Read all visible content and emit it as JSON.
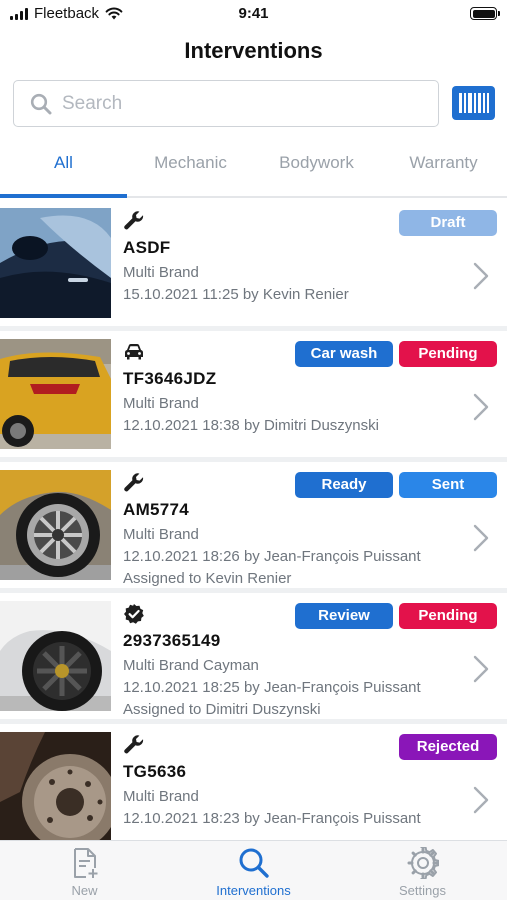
{
  "status_bar": {
    "carrier": "Fleetback",
    "time": "9:41"
  },
  "header": {
    "title": "Interventions"
  },
  "search": {
    "placeholder": "Search",
    "value": ""
  },
  "tabs": [
    {
      "label": "All",
      "active": true
    },
    {
      "label": "Mechanic",
      "active": false
    },
    {
      "label": "Bodywork",
      "active": false
    },
    {
      "label": "Warranty",
      "active": false
    }
  ],
  "interventions": [
    {
      "icon": "wrench-icon",
      "plate": "ASDF",
      "brand": "Multi Brand",
      "meta": "15.10.2021 11:25 by Kevin Renier",
      "assigned": "",
      "badges": [
        {
          "label": "Draft",
          "color": "#8fb6e6"
        }
      ]
    },
    {
      "icon": "car-icon",
      "plate": "TF3646JDZ",
      "brand": "Multi Brand",
      "meta": "12.10.2021 18:38 by Dimitri Duszynski",
      "assigned": "",
      "badges": [
        {
          "label": "Car wash",
          "color": "#1f6fd0"
        },
        {
          "label": "Pending",
          "color": "#e3124b"
        }
      ]
    },
    {
      "icon": "wrench-icon",
      "plate": "AM5774",
      "brand": "Multi Brand",
      "meta": "12.10.2021 18:26 by Jean-François Puissant",
      "assigned": "Assigned to Kevin Renier",
      "badges": [
        {
          "label": "Ready",
          "color": "#1f6fd0"
        },
        {
          "label": "Sent",
          "color": "#2a86e8"
        }
      ]
    },
    {
      "icon": "verified-badge-icon",
      "plate": "2937365149",
      "brand": "Multi Brand Cayman",
      "meta": "12.10.2021 18:25 by Jean-François Puissant",
      "assigned": "Assigned to Dimitri Duszynski",
      "badges": [
        {
          "label": "Review",
          "color": "#1f6fd0"
        },
        {
          "label": "Pending",
          "color": "#e3124b"
        }
      ]
    },
    {
      "icon": "wrench-icon",
      "plate": "TG5636",
      "brand": "Multi Brand",
      "meta": "12.10.2021 18:23 by Jean-François Puissant",
      "assigned": "",
      "badges": [
        {
          "label": "Rejected",
          "color": "#8a16b8"
        }
      ]
    }
  ],
  "tabbar": [
    {
      "label": "New",
      "icon": "new-document-icon",
      "active": false
    },
    {
      "label": "Interventions",
      "icon": "search-icon",
      "active": true
    },
    {
      "label": "Settings",
      "icon": "gear-icon",
      "active": false
    }
  ],
  "colors": {
    "accent": "#1f6fd0",
    "pending": "#e3124b",
    "rejected": "#8a16b8",
    "draft": "#8fb6e6"
  }
}
